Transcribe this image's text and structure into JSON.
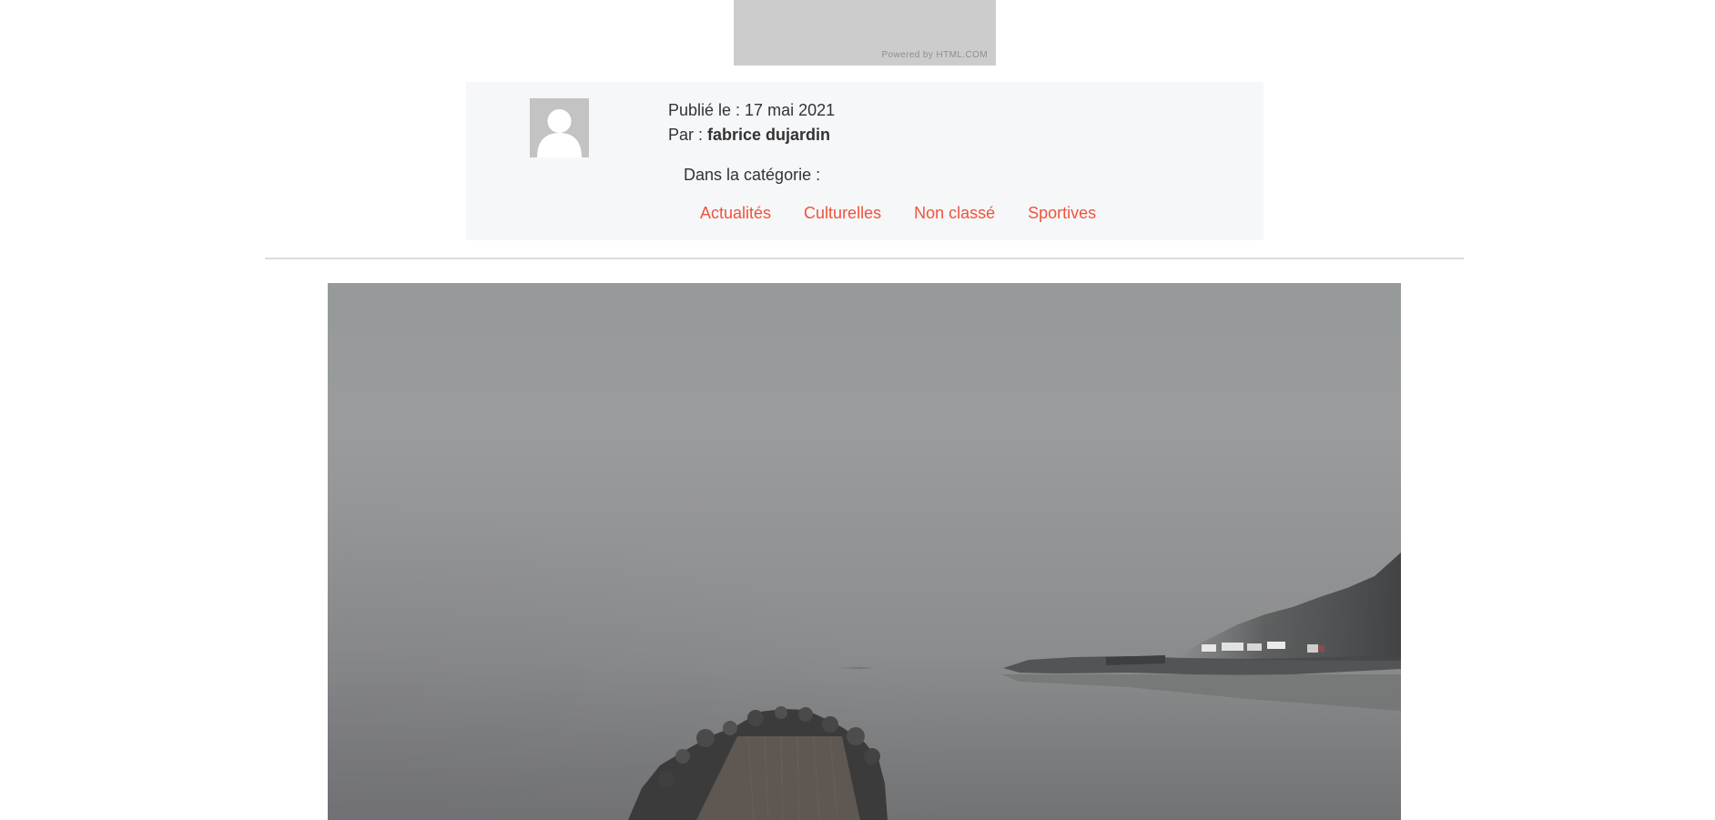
{
  "ad": {
    "credit": "Powered by HTML.COM"
  },
  "post_meta": {
    "published": "Publié le : 17 mai 2021",
    "author_prefix": "Par : ",
    "author_name": "fabrice dujardin",
    "category_label": "Dans la catégorie :",
    "categories": [
      "Actualités",
      "Culturelles",
      "Non classé",
      "Sportives"
    ]
  },
  "colors": {
    "link": "#f0533a",
    "meta_background": "#f6f7f9",
    "text": "#333333"
  },
  "icons": {
    "avatar": "user-silhouette-icon"
  }
}
